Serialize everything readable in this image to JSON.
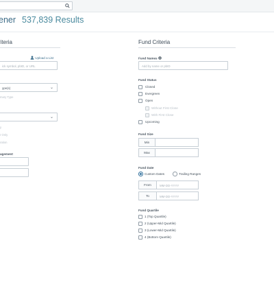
{
  "header": {
    "page_title": "ener",
    "results": "537,839 Results"
  },
  "left": {
    "title": "riteria",
    "upload_label": "Upload a List",
    "identifier_placeholder": "ick symbol, pbID, or URL",
    "type_select": "ype(s)",
    "type_hint": "mary Type",
    "second_select": "",
    "faint_1": "y",
    "faint_2": "r Only",
    "faint_3": "ration",
    "management_label": "agement"
  },
  "fund": {
    "title": "Fund Criteria",
    "names_label": "Fund Names",
    "names_placeholder": "Add by name or pbID",
    "status_label": "Fund Status",
    "status_options": [
      "Closed",
      "Evergreen",
      "Open",
      "Upcoming"
    ],
    "open_sub_options": [
      "Without First Close",
      "With First Close"
    ],
    "size_label": "Fund Size",
    "size_min": "Min",
    "size_max": "Max",
    "date_label": "Fund Date",
    "date_modes": [
      "Custom Dates",
      "Trailing Ranges"
    ],
    "date_from": "From",
    "date_to": "To",
    "date_placeholder": "MM-DD-YYYY",
    "quartile_label": "Fund Quartile",
    "quartiles": [
      "1 (Top Quartile)",
      "2 (Upper-Mid Quartile)",
      "3 (Lower-Mid Quartile)",
      "4 (Bottom Quartile)"
    ]
  }
}
